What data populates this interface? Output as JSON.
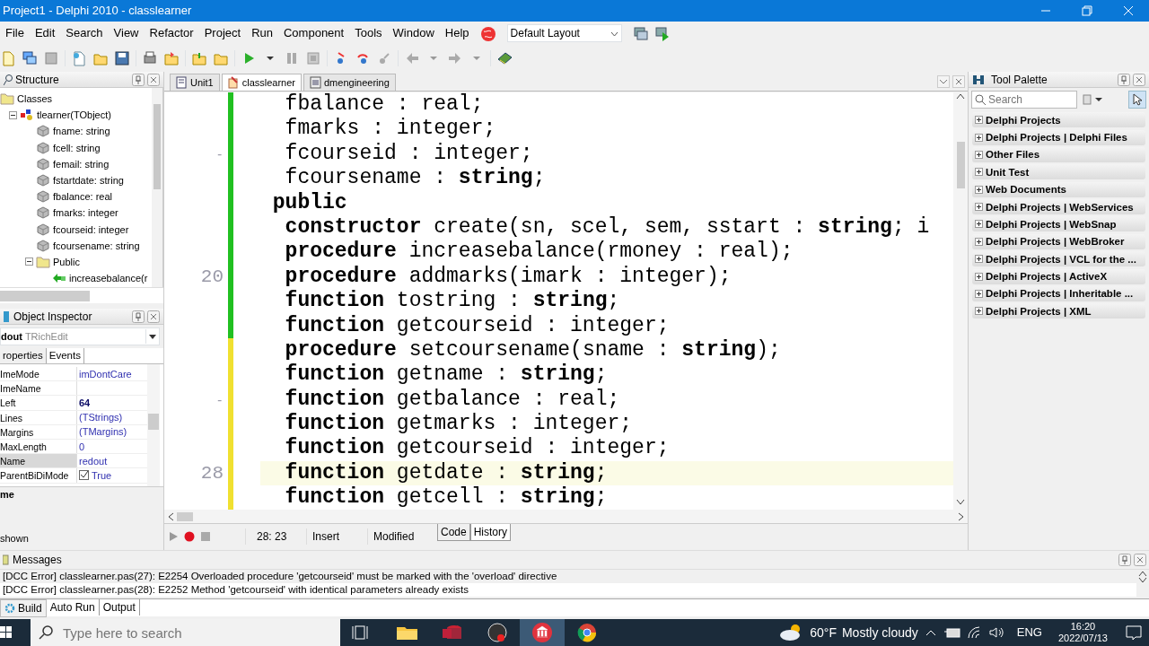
{
  "window": {
    "title": "Project1 - Delphi 2010 - classlearner"
  },
  "menu": [
    "File",
    "Edit",
    "Search",
    "View",
    "Refactor",
    "Project",
    "Run",
    "Component",
    "Tools",
    "Window",
    "Help"
  ],
  "layout_select": {
    "value": "Default Layout"
  },
  "structure": {
    "title": "Structure",
    "tree": [
      {
        "label": "Classes",
        "kind": "folder",
        "children": [
          {
            "label": "tlearner(TObject)",
            "kind": "class",
            "expanded": true,
            "children": [
              {
                "label": "fname: string",
                "kind": "field"
              },
              {
                "label": "fcell: string",
                "kind": "field"
              },
              {
                "label": "femail: string",
                "kind": "field"
              },
              {
                "label": "fstartdate: string",
                "kind": "field"
              },
              {
                "label": "fbalance: real",
                "kind": "field"
              },
              {
                "label": "fmarks: integer",
                "kind": "field"
              },
              {
                "label": "fcourseid: integer",
                "kind": "field"
              },
              {
                "label": "fcoursename: string",
                "kind": "field"
              },
              {
                "label": "Public",
                "kind": "folder",
                "expanded": true,
                "children": [
                  {
                    "label": "increasebalance(r",
                    "kind": "method"
                  }
                ]
              }
            ]
          }
        ]
      }
    ]
  },
  "object_inspector": {
    "title": "Object Inspector",
    "component_name": "dout",
    "component_type": "TRichEdit",
    "tabs": [
      {
        "label": "roperties",
        "selected": true
      },
      {
        "label": "Events",
        "selected": false
      }
    ],
    "properties": [
      {
        "name": "ImeMode",
        "value": "imDontCare",
        "modified": false,
        "selected": false
      },
      {
        "name": "ImeName",
        "selected": false
      },
      {
        "name": "Left",
        "value": "64",
        "modified": true,
        "selected": false
      },
      {
        "name": "Lines",
        "value": "(TStrings)",
        "modified": false,
        "selected": false
      },
      {
        "name": "Margins",
        "value": "(TMargins)",
        "modified": false,
        "selected": false
      },
      {
        "name": "MaxLength",
        "value": "0",
        "modified": false,
        "selected": false
      },
      {
        "name": "Name",
        "value": "redout",
        "modified": false,
        "selected": true
      },
      {
        "name": "ParentBiDiMode",
        "value": "True",
        "kind": "checkbox",
        "checked": true,
        "modified": false,
        "selected": false
      }
    ],
    "description": "me",
    "status": "shown"
  },
  "editor": {
    "tabs": [
      {
        "label": "Unit1",
        "selected": false
      },
      {
        "label": "classlearner",
        "selected": true
      },
      {
        "label": "dmengineering",
        "selected": false
      }
    ],
    "lines": [
      {
        "modified": false,
        "current": false,
        "text": "  fbalance : real;"
      },
      {
        "modified": false,
        "current": false,
        "text": "  fmarks : integer;"
      },
      {
        "gutter": "-",
        "modified": false,
        "current": false,
        "text": "  fcourseid : integer;"
      },
      {
        "modified": false,
        "current": false,
        "text": "  fcoursename : **string**;"
      },
      {
        "modified": false,
        "current": false,
        "text": " **public**"
      },
      {
        "modified": false,
        "current": false,
        "text": "  **constructor** create(sn, scel, sem, sstart : **string**; i"
      },
      {
        "modified": false,
        "current": false,
        "text": "  **procedure** increasebalance(rmoney : real);"
      },
      {
        "gutter": "20",
        "modified": false,
        "current": false,
        "text": "  **procedure** addmarks(imark : integer);"
      },
      {
        "modified": false,
        "current": false,
        "text": "  **function** tostring : **string**;"
      },
      {
        "modified": false,
        "current": false,
        "text": "  **function** getcourseid : integer;"
      },
      {
        "modified": true,
        "current": false,
        "text": "  **procedure** setcoursename(sname : **string**);"
      },
      {
        "modified": true,
        "current": false,
        "text": "  **function** getname : **string**;"
      },
      {
        "gutter": "-",
        "modified": true,
        "current": false,
        "text": "  **function** getbalance : real;"
      },
      {
        "modified": true,
        "current": false,
        "text": "  **function** getmarks : integer;"
      },
      {
        "modified": true,
        "current": false,
        "text": "  **function** getcourseid : integer;"
      },
      {
        "gutter": "28",
        "modified": true,
        "current": true,
        "text": "  **function** getdate : **string**;"
      },
      {
        "modified": true,
        "current": false,
        "text": "  **function** getcell : **string**;"
      }
    ],
    "position": "28: 23",
    "mode": "Insert",
    "state": "Modified",
    "view_tabs": [
      {
        "label": "Code",
        "selected": true
      },
      {
        "label": "History",
        "selected": false
      }
    ]
  },
  "tool_palette": {
    "title": "Tool Palette",
    "search_placeholder": "Search",
    "categories": [
      "Delphi Projects",
      "Delphi Projects | Delphi Files",
      "Other Files",
      "Unit Test",
      "Web Documents",
      "Delphi Projects | WebServices",
      "Delphi Projects | WebSnap",
      "Delphi Projects | WebBroker",
      "Delphi Projects | VCL for the ...",
      "Delphi Projects | ActiveX",
      "Delphi Projects | Inheritable ...",
      "Delphi Projects | XML"
    ]
  },
  "messages": {
    "title": "Messages",
    "lines": [
      "[DCC Error] classlearner.pas(27): E2254 Overloaded procedure 'getcourseid' must be marked with the 'overload' directive",
      "[DCC Error] classlearner.pas(28): E2252 Method 'getcourseid' with identical parameters already exists"
    ],
    "tabs": [
      {
        "label": "Build",
        "selected": true
      },
      {
        "label": "Auto Run",
        "selected": false
      },
      {
        "label": "Output",
        "selected": false
      }
    ]
  },
  "taskbar": {
    "search_placeholder": "Type here to search",
    "temperature": "60°F",
    "weather": "Mostly cloudy",
    "language": "ENG",
    "time": "16:20",
    "date": "2022/07/13"
  }
}
